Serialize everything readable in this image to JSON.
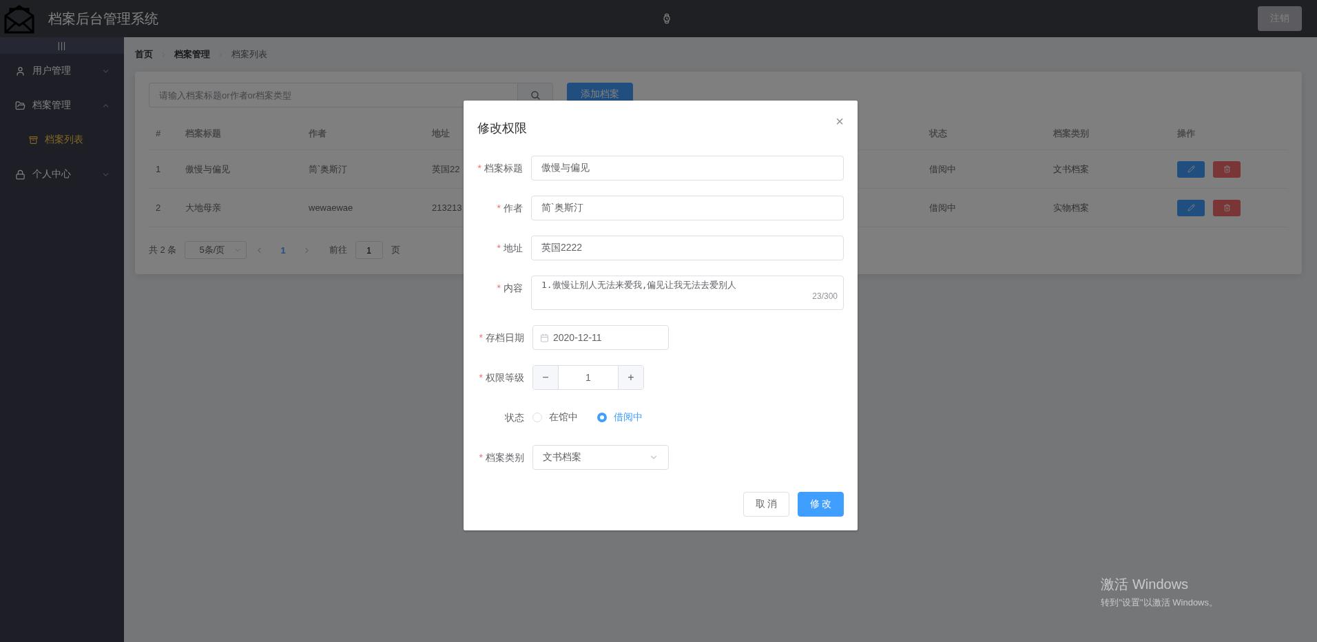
{
  "header": {
    "title": "档案后台管理系统",
    "logout": "注销"
  },
  "sidebar": {
    "toggle": "|||",
    "items": [
      {
        "label": "用户管理",
        "expanded": false
      },
      {
        "label": "档案管理",
        "expanded": true,
        "children": [
          {
            "label": "档案列表",
            "selected": true
          }
        ]
      },
      {
        "label": "个人中心",
        "expanded": false
      }
    ]
  },
  "breadcrumb": [
    {
      "label": "首页",
      "current": false
    },
    {
      "label": "档案管理",
      "current": false
    },
    {
      "label": "档案列表",
      "current": true
    }
  ],
  "search": {
    "placeholder": "请输入档案标题or作者or档案类型"
  },
  "add_button": "添加档案",
  "table": {
    "columns": [
      {
        "label": "#",
        "kind": "text"
      },
      {
        "label": "档案标题",
        "kind": "text"
      },
      {
        "label": "作者",
        "kind": "text"
      },
      {
        "label": "地址",
        "kind": "text"
      },
      {
        "kind": "hidden"
      },
      {
        "label": "状态",
        "kind": "text"
      },
      {
        "label": "档案类别",
        "kind": "text"
      },
      {
        "label": "操作",
        "kind": "actions"
      }
    ],
    "rows": [
      {
        "cells": [
          "1",
          "傲慢与偏见",
          "简`奥斯汀",
          "英国22",
          "",
          "借阅中",
          "文书档案",
          ""
        ]
      },
      {
        "cells": [
          "2",
          "大地母亲",
          "wewaewae",
          "213213",
          "",
          "借阅中",
          "实物档案",
          ""
        ]
      }
    ]
  },
  "pagination": {
    "total": "共 2 条",
    "page_size": "5条/页",
    "pages": [
      {
        "label": "1",
        "selected": true
      }
    ],
    "goto_label": "前往",
    "goto_value": "1",
    "goto_suffix": "页"
  },
  "dialog": {
    "title": "修改权限",
    "close": "×",
    "required_mark": "*",
    "fields": [
      {
        "label": "档案标题",
        "kind": "text",
        "required": true,
        "value": "傲慢与偏见"
      },
      {
        "label": "作者",
        "kind": "text",
        "required": true,
        "value": "简`奥斯汀"
      },
      {
        "label": "地址",
        "kind": "text",
        "required": true,
        "value": "英国2222"
      },
      {
        "label": "内容",
        "kind": "textarea",
        "required": true,
        "value": "1.傲慢让别人无法来爱我,偏见让我无法去爱别人",
        "counter": "23/300"
      },
      {
        "label": "存档日期",
        "kind": "date",
        "required": true,
        "value": "2020-12-11"
      },
      {
        "label": "权限等级",
        "kind": "number",
        "required": true,
        "value": "1",
        "minus": "−",
        "plus": "+"
      },
      {
        "label": "状态",
        "kind": "radio",
        "required": false,
        "options": [
          {
            "label": "在馆中",
            "selected": false
          },
          {
            "label": "借阅中",
            "selected": true
          }
        ]
      },
      {
        "label": "档案类别",
        "kind": "select",
        "required": true,
        "value": "文书档案"
      }
    ],
    "buttons": [
      {
        "label": "取 消",
        "kind": "default"
      },
      {
        "label": "修 改",
        "kind": "primary"
      }
    ]
  },
  "windows_notice": {
    "title": "激活 Windows",
    "subtitle": "转到\"设置\"以激活 Windows。"
  }
}
